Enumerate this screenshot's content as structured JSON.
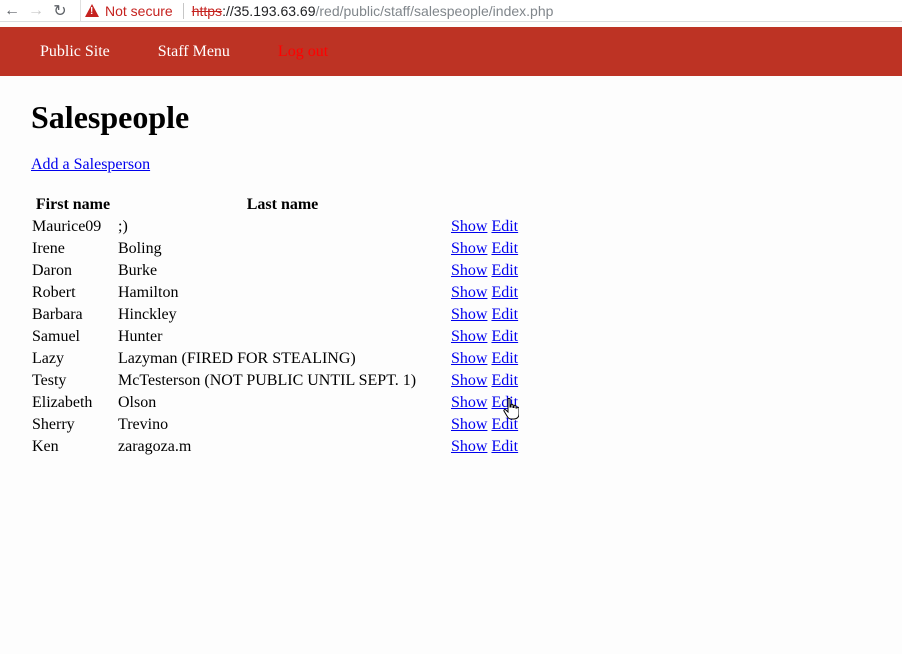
{
  "browser": {
    "not_secure_label": "Not secure",
    "url_scheme": "https",
    "url_host": "://35.193.63.69",
    "url_path": "/red/public/staff/salespeople/index.php"
  },
  "header": {
    "public_site": "Public Site",
    "staff_menu": "Staff Menu",
    "log_out": "Log out"
  },
  "page": {
    "title": "Salespeople",
    "add_link": "Add a Salesperson"
  },
  "table": {
    "columns": [
      "First name",
      "Last name",
      ""
    ],
    "action_show": "Show",
    "action_edit": "Edit",
    "rows": [
      {
        "first": "Maurice09",
        "last": ";)"
      },
      {
        "first": "Irene",
        "last": "Boling"
      },
      {
        "first": "Daron",
        "last": "Burke"
      },
      {
        "first": "Robert",
        "last": "Hamilton"
      },
      {
        "first": "Barbara",
        "last": "Hinckley"
      },
      {
        "first": "Samuel",
        "last": "Hunter"
      },
      {
        "first": "Lazy",
        "last": "Lazyman (FIRED FOR STEALING)"
      },
      {
        "first": "Testy",
        "last": "McTesterson (NOT PUBLIC UNTIL SEPT. 1)"
      },
      {
        "first": "Elizabeth",
        "last": "Olson"
      },
      {
        "first": "Sherry",
        "last": "Trevino"
      },
      {
        "first": "Ken",
        "last": "zaragoza.m"
      }
    ]
  },
  "colors": {
    "header_bg": "#bd3324",
    "link": "#0000ee",
    "logout": "#ff0000"
  }
}
